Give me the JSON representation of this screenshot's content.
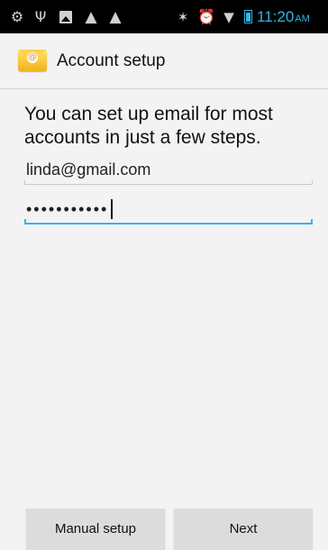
{
  "status_bar": {
    "icons": [
      "usb-debug-icon",
      "usb-icon",
      "picture-notification-icon",
      "warning-icon",
      "warning-icon",
      "bluetooth-icon",
      "alarm-icon",
      "wifi-icon",
      "battery-charging-icon"
    ],
    "time": "11:20",
    "ampm": "AM",
    "accent_color": "#33b5e5"
  },
  "action_bar": {
    "title": "Account setup",
    "icon": "email-app-icon"
  },
  "main": {
    "intro": "You can set up email for most accounts in just a few steps.",
    "email_value": "linda@gmail.com",
    "password_value": "•••••••••••",
    "focus_color": "#33b5e5"
  },
  "buttons": {
    "manual_setup": "Manual setup",
    "next": "Next"
  }
}
